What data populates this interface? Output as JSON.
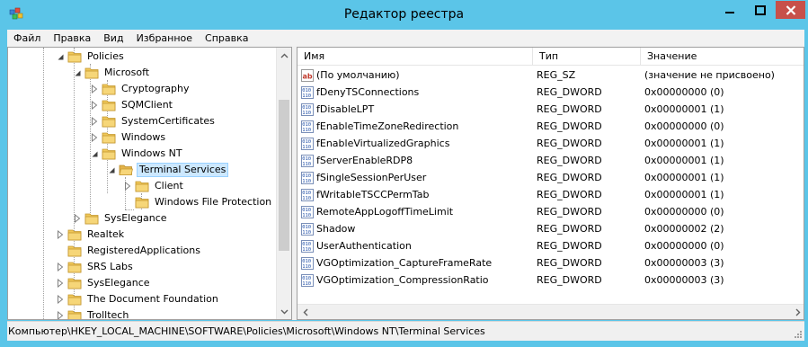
{
  "window": {
    "title": "Редактор реестра",
    "icons": {
      "app": "regedit-icon",
      "minimize": "minimize-icon",
      "maximize": "maximize-icon",
      "close": "close-icon"
    }
  },
  "menu": [
    "Файл",
    "Правка",
    "Вид",
    "Избранное",
    "Справка"
  ],
  "tree": {
    "nodes": [
      {
        "label": "Policies",
        "expander": "expanded"
      },
      {
        "label": "Microsoft",
        "expander": "expanded"
      },
      {
        "label": "Cryptography",
        "expander": "collapsed"
      },
      {
        "label": "SQMClient",
        "expander": "collapsed"
      },
      {
        "label": "SystemCertificates",
        "expander": "collapsed"
      },
      {
        "label": "Windows",
        "expander": "collapsed"
      },
      {
        "label": "Windows NT",
        "expander": "expanded"
      },
      {
        "label": "Terminal Services",
        "expander": "expanded",
        "selected": true
      },
      {
        "label": "Client",
        "expander": "collapsed"
      },
      {
        "label": "Windows File Protection",
        "expander": "none"
      },
      {
        "label": "SysElegance",
        "expander": "collapsed"
      },
      {
        "label": "Realtek",
        "expander": "collapsed"
      },
      {
        "label": "RegisteredApplications",
        "expander": "none"
      },
      {
        "label": "SRS Labs",
        "expander": "collapsed"
      },
      {
        "label": "SysElegance",
        "expander": "collapsed"
      },
      {
        "label": "The Document Foundation",
        "expander": "collapsed"
      },
      {
        "label": "Trolltech",
        "expander": "collapsed"
      }
    ]
  },
  "list": {
    "columns": {
      "name": "Имя",
      "type": "Тип",
      "data": "Значение"
    },
    "rows": [
      {
        "icon": "string-value-icon",
        "name": "(По умолчанию)",
        "type": "REG_SZ",
        "data": "(значение не присвоено)"
      },
      {
        "icon": "binary-value-icon",
        "name": "fDenyTSConnections",
        "type": "REG_DWORD",
        "data": "0x00000000 (0)"
      },
      {
        "icon": "binary-value-icon",
        "name": "fDisableLPT",
        "type": "REG_DWORD",
        "data": "0x00000001 (1)"
      },
      {
        "icon": "binary-value-icon",
        "name": "fEnableTimeZoneRedirection",
        "type": "REG_DWORD",
        "data": "0x00000000 (0)"
      },
      {
        "icon": "binary-value-icon",
        "name": "fEnableVirtualizedGraphics",
        "type": "REG_DWORD",
        "data": "0x00000001 (1)"
      },
      {
        "icon": "binary-value-icon",
        "name": "fServerEnableRDP8",
        "type": "REG_DWORD",
        "data": "0x00000001 (1)"
      },
      {
        "icon": "binary-value-icon",
        "name": "fSingleSessionPerUser",
        "type": "REG_DWORD",
        "data": "0x00000001 (1)"
      },
      {
        "icon": "binary-value-icon",
        "name": "fWritableTSCCPermTab",
        "type": "REG_DWORD",
        "data": "0x00000001 (1)"
      },
      {
        "icon": "binary-value-icon",
        "name": "RemoteAppLogoffTimeLimit",
        "type": "REG_DWORD",
        "data": "0x00000000 (0)"
      },
      {
        "icon": "binary-value-icon",
        "name": "Shadow",
        "type": "REG_DWORD",
        "data": "0x00000002 (2)"
      },
      {
        "icon": "binary-value-icon",
        "name": "UserAuthentication",
        "type": "REG_DWORD",
        "data": "0x00000000 (0)"
      },
      {
        "icon": "binary-value-icon",
        "name": "VGOptimization_CaptureFrameRate",
        "type": "REG_DWORD",
        "data": "0x00000003 (3)"
      },
      {
        "icon": "binary-value-icon",
        "name": "VGOptimization_CompressionRatio",
        "type": "REG_DWORD",
        "data": "0x00000003 (3)"
      }
    ]
  },
  "status": {
    "path": "Компьютер\\HKEY_LOCAL_MACHINE\\SOFTWARE\\Policies\\Microsoft\\Windows NT\\Terminal Services"
  },
  "colors": {
    "titlebar": "#5bc5e8",
    "close_button": "#c7504a",
    "selection": "#cce8ff",
    "folder": "#e8c05a"
  }
}
